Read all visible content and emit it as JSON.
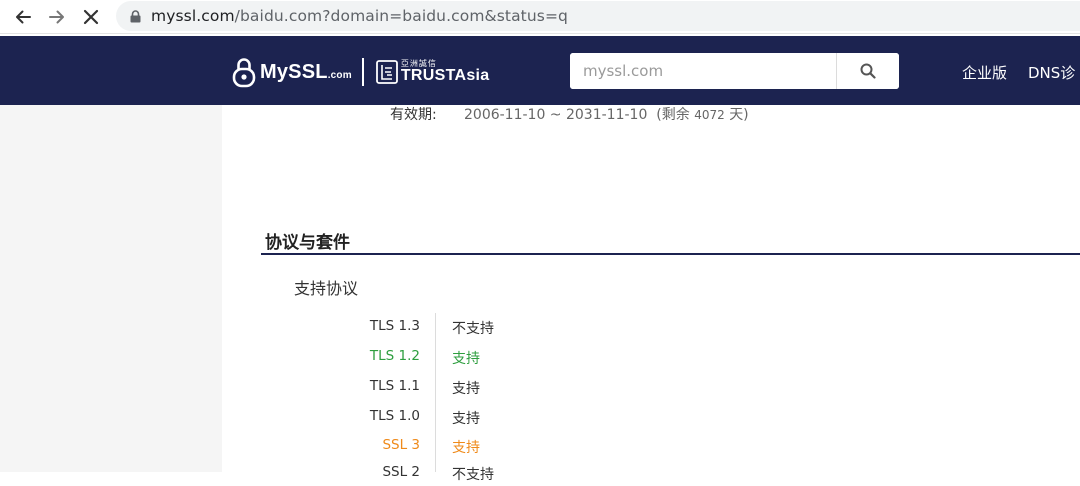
{
  "browser": {
    "url_host": "myssl.com",
    "url_rest": "/baidu.com?domain=baidu.com&status=q",
    "icons": [
      "back-arrow-icon",
      "forward-arrow-icon",
      "close-icon",
      "lock-icon"
    ]
  },
  "header": {
    "logo_text": "MySSL",
    "logo_suffix": ".com",
    "partner_cn": "亞洲誠信",
    "partner_en": "TRUSTAsia",
    "search_placeholder": "myssl.com",
    "nav": [
      "企业版",
      "DNS诊"
    ],
    "colors": {
      "background": "#1c2350",
      "text": "#ffffff"
    }
  },
  "cert": {
    "validity_label": "有效期:",
    "validity_range": "2006-11-10 ~ 2031-11-10",
    "remaining_prefix": "(剩余",
    "remaining_days": "4072",
    "remaining_suffix": "天)"
  },
  "section": {
    "title": "协议与套件",
    "subtitle": "支持协议"
  },
  "protocols": [
    {
      "name": "TLS 1.3",
      "status": "不支持",
      "color": "#333333"
    },
    {
      "name": "TLS 1.2",
      "status": "支持",
      "color": "#2e9e3f"
    },
    {
      "name": "TLS 1.1",
      "status": "支持",
      "color": "#333333"
    },
    {
      "name": "TLS 1.0",
      "status": "支持",
      "color": "#333333"
    },
    {
      "name": "SSL 3",
      "status": "支持",
      "color": "#ef8a1a"
    },
    {
      "name": "SSL 2",
      "status": "不支持",
      "color": "#333333"
    }
  ]
}
